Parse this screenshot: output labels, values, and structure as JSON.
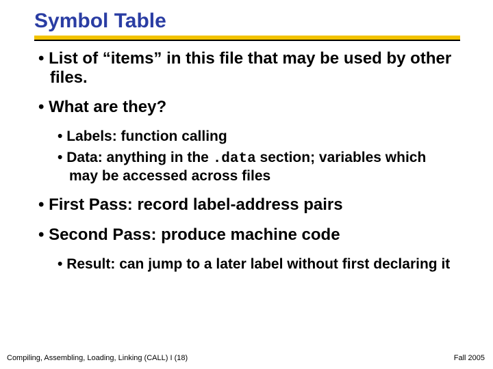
{
  "title": "Symbol Table",
  "bullets": {
    "b1": "List of “items” in this file that may be used by other files.",
    "b2": "What are they?",
    "b2_sub1": "Labels: function calling",
    "b2_sub2a": "Data: anything in the ",
    "b2_sub2_code": ".data",
    "b2_sub2b": " section; variables which may be accessed across files",
    "b3": "First Pass: record label-address pairs",
    "b4": "Second Pass: produce machine code",
    "b4_sub1": "Result: can jump to a later label without first declaring it"
  },
  "footer": {
    "left": "Compiling, Assembling, Loading, Linking (CALL) I (18)",
    "right": "Fall 2005"
  }
}
